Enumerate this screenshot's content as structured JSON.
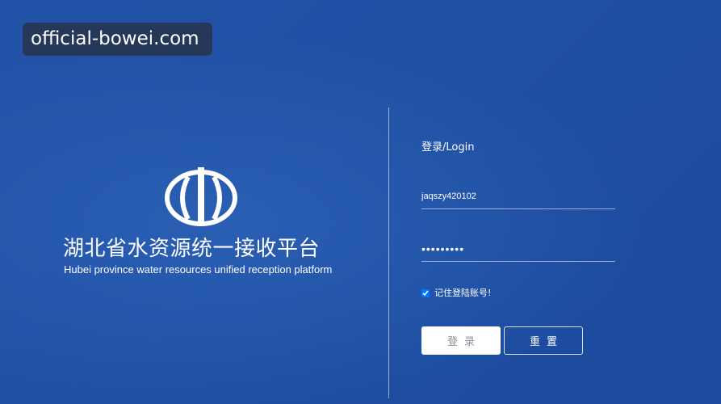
{
  "watermark": {
    "text": "official-bowei.com"
  },
  "branding": {
    "logo_icon": "water-emblem-icon",
    "title_cn": "湖北省水资源统一接收平台",
    "title_en": "Hubei province water resources unified reception platform"
  },
  "login": {
    "heading": "登录/Login",
    "username_value": "jaqszy420102",
    "password_value": "•••••••••",
    "remember_label": "记住登陆账号!",
    "remember_checked": true,
    "login_button": "登录",
    "reset_button": "重置"
  },
  "colors": {
    "background": "#1f4fa3",
    "text": "#ffffff",
    "login_button_bg": "#ffffff",
    "login_button_text": "#8a8f99"
  }
}
